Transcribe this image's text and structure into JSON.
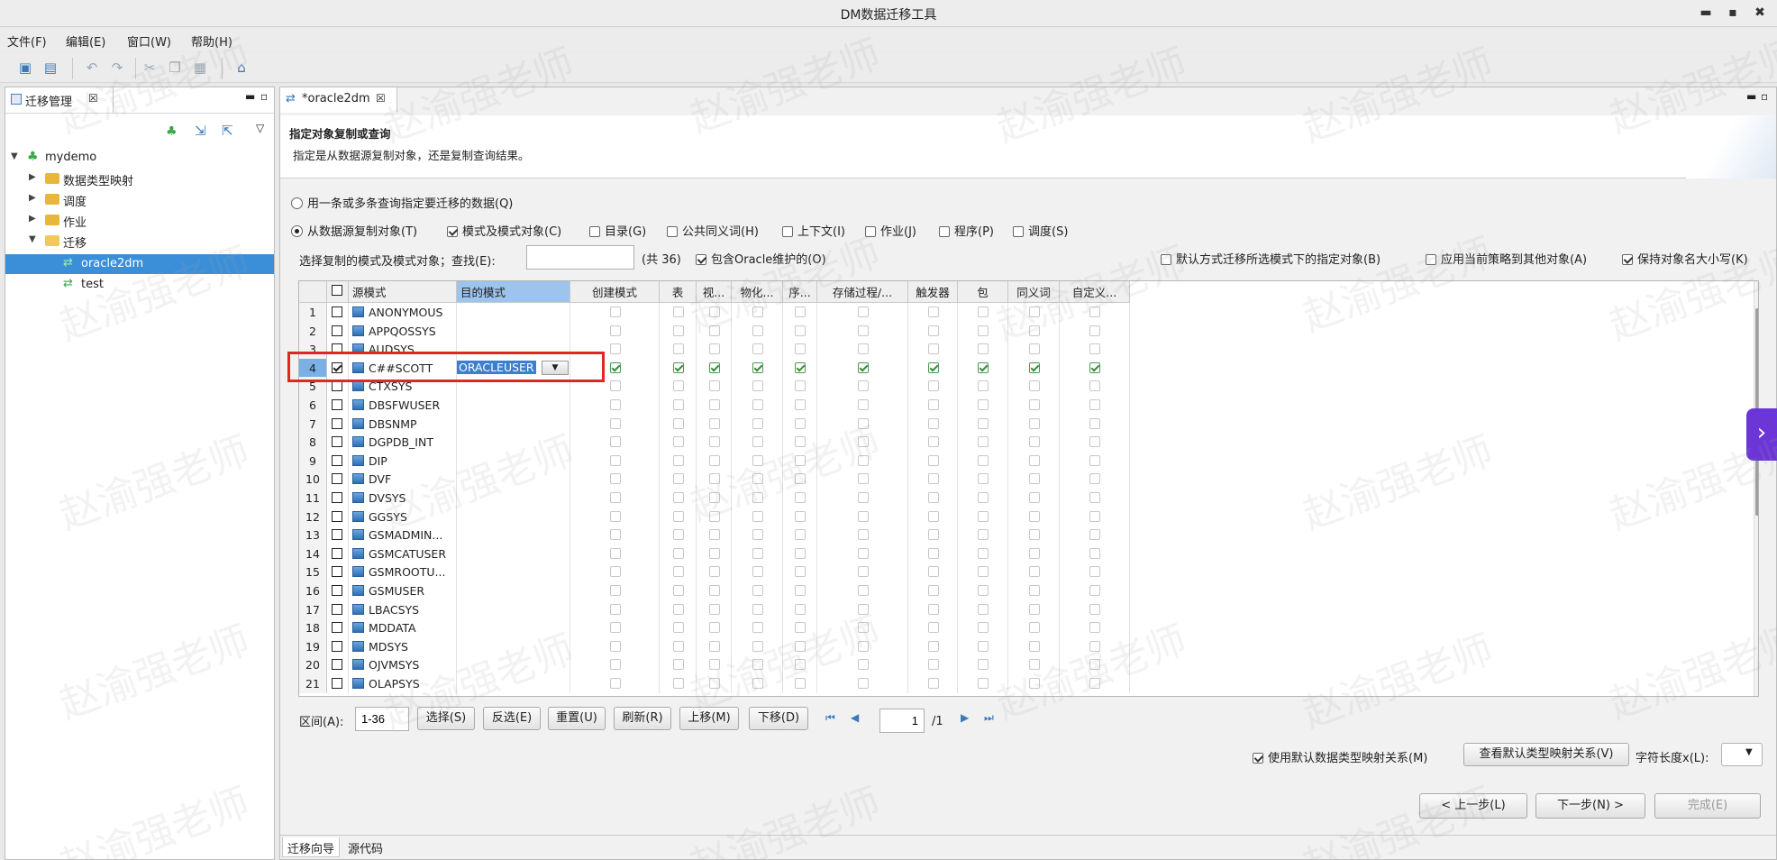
{
  "window": {
    "title": "DM数据迁移工具",
    "min": "▬",
    "max": "▪",
    "close": "✖"
  },
  "menu": [
    "文件(F)",
    "编辑(E)",
    "窗口(W)",
    "帮助(H)"
  ],
  "left": {
    "tab_label": "迁移管理",
    "tree": [
      {
        "label": "mydemo"
      },
      {
        "label": "数据类型映射"
      },
      {
        "label": "调度"
      },
      {
        "label": "作业"
      },
      {
        "label": "迁移"
      },
      {
        "label": "oracle2dm"
      },
      {
        "label": "test"
      }
    ]
  },
  "editor": {
    "tab_label": "*oracle2dm",
    "header_title": "指定对象复制或查询",
    "header_desc": "指定是从数据源复制对象，还是复制查询结果。",
    "radio_query": "用一条或多条查询指定要迁移的数据(Q)",
    "radio_copy": "从数据源复制对象(T)",
    "obj_options": [
      {
        "label": "模式及模式对象(C)",
        "checked": true
      },
      {
        "label": "目录(G)",
        "checked": false
      },
      {
        "label": "公共同义词(H)",
        "checked": false
      },
      {
        "label": "上下文(I)",
        "checked": false
      },
      {
        "label": "作业(J)",
        "checked": false
      },
      {
        "label": "程序(P)",
        "checked": false
      },
      {
        "label": "调度(S)",
        "checked": false
      }
    ],
    "find_label": "选择复制的模式及模式对象；查找(E):",
    "find_value": "",
    "count_text": "(共 36)",
    "include_oracle": "包含Oracle维护的(O)",
    "default_migrate": "默认方式迁移所选模式下的指定对象(B)",
    "apply_policy": "应用当前策略到其他对象(A)",
    "keep_case": "保持对象名大小写(K)"
  },
  "grid": {
    "headers": [
      "源模式",
      "目的模式",
      "创建模式",
      "表",
      "视...",
      "物化...",
      "序...",
      "存储过程/...",
      "触发器",
      "包",
      "同义词",
      "自定义..."
    ],
    "rows": [
      {
        "n": "1",
        "name": "ANONYMOUS",
        "checked": false,
        "target": ""
      },
      {
        "n": "2",
        "name": "APPQOSSYS",
        "checked": false,
        "target": ""
      },
      {
        "n": "3",
        "name": "AUDSYS",
        "checked": false,
        "target": ""
      },
      {
        "n": "4",
        "name": "C##SCOTT",
        "checked": true,
        "target": "ORACLEUSER"
      },
      {
        "n": "5",
        "name": "CTXSYS",
        "checked": false,
        "target": ""
      },
      {
        "n": "6",
        "name": "DBSFWUSER",
        "checked": false,
        "target": ""
      },
      {
        "n": "7",
        "name": "DBSNMP",
        "checked": false,
        "target": ""
      },
      {
        "n": "8",
        "name": "DGPDB_INT",
        "checked": false,
        "target": ""
      },
      {
        "n": "9",
        "name": "DIP",
        "checked": false,
        "target": ""
      },
      {
        "n": "10",
        "name": "DVF",
        "checked": false,
        "target": ""
      },
      {
        "n": "11",
        "name": "DVSYS",
        "checked": false,
        "target": ""
      },
      {
        "n": "12",
        "name": "GGSYS",
        "checked": false,
        "target": ""
      },
      {
        "n": "13",
        "name": "GSMADMIN...",
        "checked": false,
        "target": ""
      },
      {
        "n": "14",
        "name": "GSMCATUSER",
        "checked": false,
        "target": ""
      },
      {
        "n": "15",
        "name": "GSMROOTU...",
        "checked": false,
        "target": ""
      },
      {
        "n": "16",
        "name": "GSMUSER",
        "checked": false,
        "target": ""
      },
      {
        "n": "17",
        "name": "LBACSYS",
        "checked": false,
        "target": ""
      },
      {
        "n": "18",
        "name": "MDDATA",
        "checked": false,
        "target": ""
      },
      {
        "n": "19",
        "name": "MDSYS",
        "checked": false,
        "target": ""
      },
      {
        "n": "20",
        "name": "OJVMSYS",
        "checked": false,
        "target": ""
      },
      {
        "n": "21",
        "name": "OLAPSYS",
        "checked": false,
        "target": ""
      }
    ]
  },
  "range": {
    "label": "区间(A):",
    "value": "1-36"
  },
  "range_buttons": [
    "选择(S)",
    "反选(E)",
    "重置(U)",
    "刷新(R)",
    "上移(M)",
    "下移(D)"
  ],
  "pager": {
    "page": "1",
    "total": "/1"
  },
  "options": {
    "use_default_map": "使用默认数据类型映射关系(M)",
    "view_default_map": "查看默认类型映射关系(V)",
    "char_len": "字符长度x(L):"
  },
  "nav": {
    "prev": "< 上一步(L)",
    "next": "下一步(N) >",
    "finish": "完成(E)"
  },
  "bottom_tabs": [
    "迁移向导",
    "源代码"
  ],
  "watermark": "赵渝强老师",
  "colors": {
    "selection": "#3b8fd8",
    "highlight_box": "#e12626",
    "side_button": "#6c35d8"
  }
}
